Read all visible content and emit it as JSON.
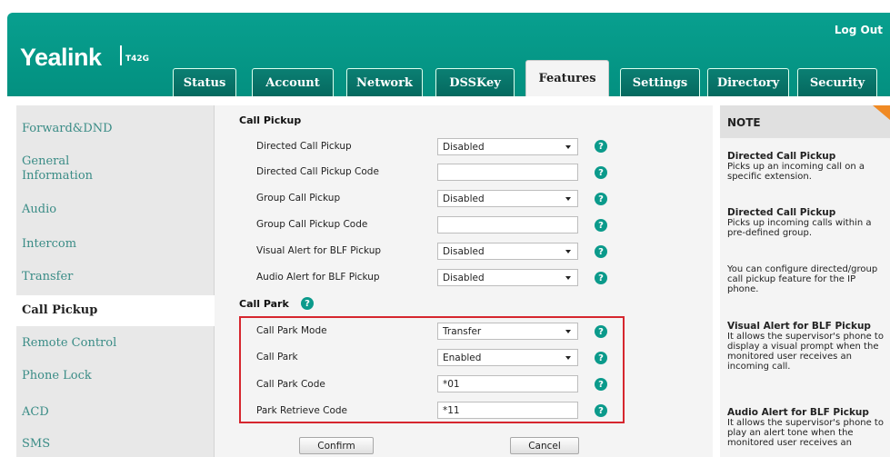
{
  "header": {
    "logout": "Log Out",
    "logo": "Yealink",
    "model": "T42G",
    "tabs": [
      "Status",
      "Account",
      "Network",
      "DSSKey",
      "Features",
      "Settings",
      "Directory",
      "Security"
    ],
    "active_tab": "Features"
  },
  "sidebar": {
    "items": [
      {
        "label": "Forward&DND"
      },
      {
        "label": "General Information"
      },
      {
        "label": "Audio"
      },
      {
        "label": "Intercom"
      },
      {
        "label": "Transfer"
      },
      {
        "label": "Call Pickup"
      },
      {
        "label": "Remote Control"
      },
      {
        "label": "Phone Lock"
      },
      {
        "label": "ACD"
      },
      {
        "label": "SMS"
      }
    ],
    "active": "Call Pickup"
  },
  "form": {
    "call_pickup_title": "Call Pickup",
    "call_park_title": "Call Park",
    "rows": [
      {
        "label": "Directed Call Pickup",
        "type": "select",
        "value": "Disabled"
      },
      {
        "label": "Directed Call Pickup Code",
        "type": "input",
        "value": ""
      },
      {
        "label": "Group Call Pickup",
        "type": "select",
        "value": "Disabled"
      },
      {
        "label": "Group Call Pickup Code",
        "type": "input",
        "value": ""
      },
      {
        "label": "Visual Alert for BLF Pickup",
        "type": "select",
        "value": "Disabled"
      },
      {
        "label": "Audio Alert for BLF Pickup",
        "type": "select",
        "value": "Disabled"
      },
      {
        "label": "Call Park Mode",
        "type": "select",
        "value": "Transfer"
      },
      {
        "label": "Call Park",
        "type": "select",
        "value": "Enabled"
      },
      {
        "label": "Call Park Code",
        "type": "input",
        "value": "*01"
      },
      {
        "label": "Park Retrieve Code",
        "type": "input",
        "value": "*11"
      }
    ],
    "confirm": "Confirm",
    "cancel": "Cancel",
    "help_glyph": "?"
  },
  "note": {
    "title": "NOTE",
    "blocks": [
      {
        "title": "Directed Call Pickup",
        "text": "Picks up an incoming call on a specific extension."
      },
      {
        "title": "Directed Call Pickup",
        "text": "Picks up incoming calls within a pre-defined group."
      },
      {
        "title": "",
        "text": "You can configure directed/group call pickup feature for the IP phone."
      },
      {
        "title": "Visual Alert for BLF Pickup",
        "text": "It allows the supervisor's phone to display a visual prompt when the monitored user receives an incoming call."
      },
      {
        "title": "Audio Alert for BLF Pickup",
        "text": "It allows the supervisor's phone to play an alert tone when the monitored user receives an"
      }
    ]
  },
  "colors": {
    "brand": "#039080",
    "highlight": "#d6262e",
    "note_accent": "#f08a24"
  }
}
